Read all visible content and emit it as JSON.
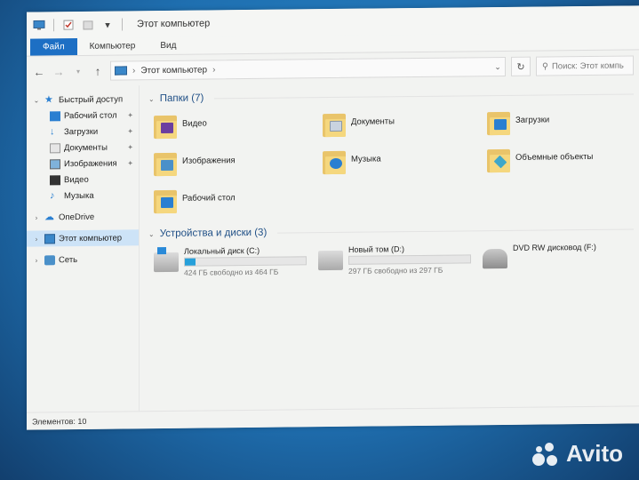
{
  "window": {
    "title": "Этот компьютер"
  },
  "ribbon": {
    "tabs": [
      {
        "label": "Файл"
      },
      {
        "label": "Компьютер"
      },
      {
        "label": "Вид"
      }
    ]
  },
  "address": {
    "path": "Этот компьютер",
    "search_placeholder": "Поиск: Этот компь"
  },
  "sidebar": {
    "quick_access": "Быстрый доступ",
    "items": [
      {
        "label": "Рабочий стол"
      },
      {
        "label": "Загрузки"
      },
      {
        "label": "Документы"
      },
      {
        "label": "Изображения"
      },
      {
        "label": "Видео"
      },
      {
        "label": "Музыка"
      }
    ],
    "onedrive": "OneDrive",
    "this_pc": "Этот компьютер",
    "network": "Сеть"
  },
  "folders_group": {
    "title": "Папки (7)"
  },
  "folders": [
    {
      "label": "Видео",
      "color": "#6b3fa0"
    },
    {
      "label": "Документы",
      "color": "#c9d3df"
    },
    {
      "label": "Загрузки",
      "color": "#2a7fd1"
    },
    {
      "label": "Изображения",
      "color": "#4a90c9"
    },
    {
      "label": "Музыка",
      "color": "#2a7fd1"
    },
    {
      "label": "Объемные объекты",
      "color": "#3fa7c9"
    },
    {
      "label": "Рабочий стол",
      "color": "#2a7fd1"
    }
  ],
  "devices_group": {
    "title": "Устройства и диски (3)"
  },
  "drives": [
    {
      "label": "Локальный диск (C:)",
      "free": "424 ГБ свободно из 464 ГБ",
      "used_fraction": 0.086
    },
    {
      "label": "Новый том (D:)",
      "free": "297 ГБ свободно из 297 ГБ",
      "used_fraction": 0.0
    },
    {
      "label": "DVD RW дисковод (F:)"
    }
  ],
  "status": {
    "items": "Элементов: 10"
  },
  "watermark": "Avito",
  "colors": {
    "accent": "#1d6fc4",
    "bar_fill": "#26a0da",
    "selected": "#cde3f7",
    "group_title": "#1f4f86"
  }
}
